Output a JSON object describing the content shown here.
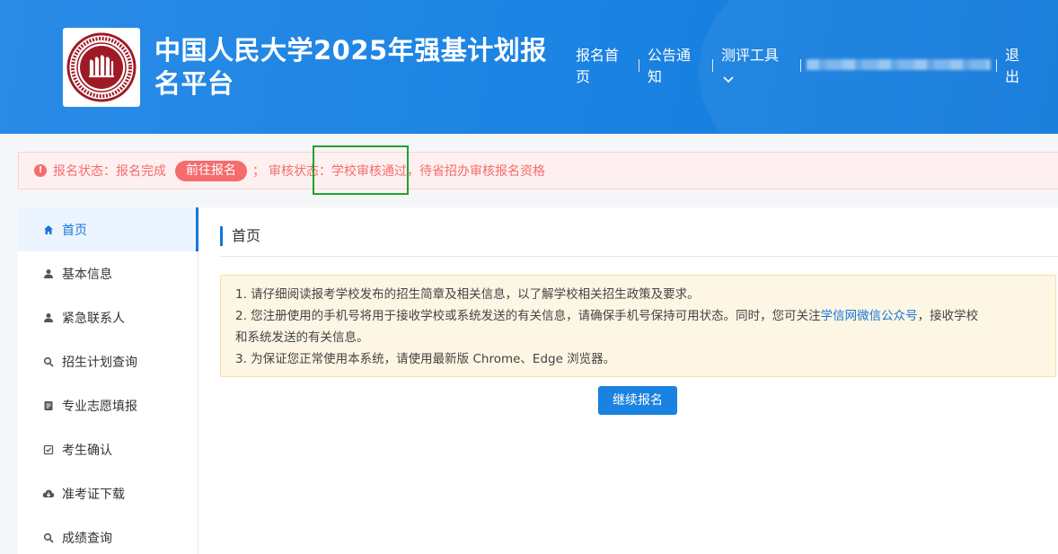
{
  "header": {
    "title": "中国人民大学2025年强基计划报名平台",
    "nav": [
      {
        "label": "报名首页"
      },
      {
        "label": "公告通知"
      },
      {
        "label": "测评工具"
      }
    ],
    "logout_label": "退出"
  },
  "status": {
    "signup_label": "报名状态：报名完成",
    "goto_button": "前往报名",
    "sep": "；",
    "review_label": "审核状态：",
    "school_result": "学校审核通过，",
    "province_result": "待省招办审核报名资格"
  },
  "sidebar": {
    "items": [
      {
        "label": "首页",
        "icon": "home-icon",
        "active": true
      },
      {
        "label": "基本信息",
        "icon": "user-icon"
      },
      {
        "label": "紧急联系人",
        "icon": "user-icon"
      },
      {
        "label": "招生计划查询",
        "icon": "search-icon"
      },
      {
        "label": "专业志愿填报",
        "icon": "document-icon"
      },
      {
        "label": "考生确认",
        "icon": "check-square-icon"
      },
      {
        "label": "准考证下载",
        "icon": "cloud-download-icon"
      },
      {
        "label": "成绩查询",
        "icon": "search-icon"
      }
    ]
  },
  "main": {
    "page_title": "首页",
    "notice": {
      "line1": "1. 请仔细阅读报考学校发布的招生简章及相关信息，以了解学校相关招生政策及要求。",
      "line2_pre": "2. 您注册使用的手机号将用于接收学校或系统发送的有关信息，请确保手机号保持可用状态。同时，您可关注",
      "line2_link": "学信网微信公众号",
      "line2_post": "，接收学校",
      "line2_cont": "和系统发送的有关信息。",
      "line3": "3. 为保证您正常使用本系统，请使用最新版 Chrome、Edge 浏览器。"
    },
    "continue_button": "继续报名"
  },
  "colors": {
    "header_blue": "#1c84e3",
    "accent": "#1677d7",
    "danger": "#f56c6c",
    "highlight_green": "#1fa22f"
  }
}
